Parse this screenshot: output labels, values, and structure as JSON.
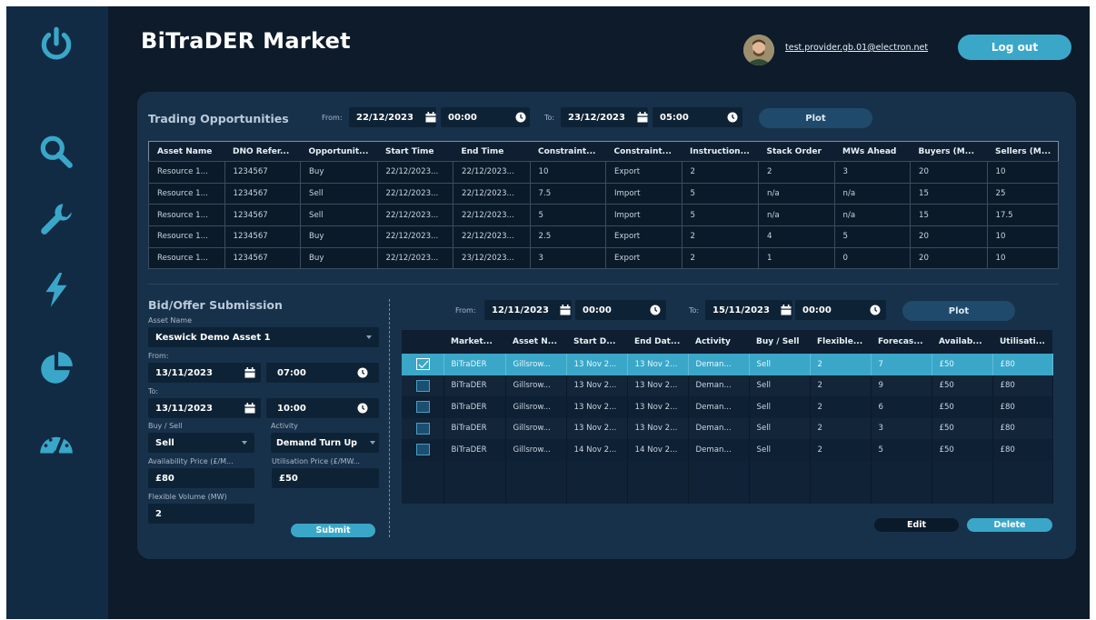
{
  "app": {
    "title": "BiTraDER Market"
  },
  "user": {
    "email": "test.provider.gb.01@electron.net",
    "avatar_icon": "user-avatar"
  },
  "header": {
    "logout_label": "Log out"
  },
  "sidebar": {
    "items": [
      {
        "icon": "power-icon"
      },
      {
        "icon": "search-icon"
      },
      {
        "icon": "wrench-icon"
      },
      {
        "icon": "lightning-icon"
      },
      {
        "icon": "pie-chart-icon"
      },
      {
        "icon": "gauge-icon"
      }
    ]
  },
  "colors": {
    "accent": "#3aa7c9",
    "background": "#0d1b2a",
    "sidebar": "#112b44",
    "card": "#18314b"
  },
  "trading": {
    "title": "Trading Opportunities",
    "from_label": "From:",
    "from_date": "22/12/2023",
    "from_time": "00:00",
    "to_label": "To:",
    "to_date": "23/12/2023",
    "to_time": "05:00",
    "plot_label": "Plot",
    "columns": [
      "Asset Name",
      "DNO Refer...",
      "Opportunit...",
      "Start Time",
      "End Time",
      "Constraint...",
      "Constraint...",
      "Instruction...",
      "Stack Order",
      "MWs Ahead",
      "Buyers (M...",
      "Sellers (M..."
    ],
    "rows": [
      [
        "Resource 1...",
        "1234567",
        "Buy",
        "22/12/2023...",
        "22/12/2023...",
        "10",
        "Export",
        "2",
        "2",
        "3",
        "20",
        "10"
      ],
      [
        "Resource 1...",
        "1234567",
        "Sell",
        "22/12/2023...",
        "22/12/2023...",
        "7.5",
        "Import",
        "5",
        "n/a",
        "n/a",
        "15",
        "25"
      ],
      [
        "Resource 1...",
        "1234567",
        "Sell",
        "22/12/2023...",
        "22/12/2023...",
        "5",
        "Import",
        "5",
        "n/a",
        "n/a",
        "15",
        "17.5"
      ],
      [
        "Resource 1...",
        "1234567",
        "Buy",
        "22/12/2023...",
        "22/12/2023...",
        "2.5",
        "Export",
        "2",
        "4",
        "5",
        "20",
        "10"
      ],
      [
        "Resource 1...",
        "1234567",
        "Buy",
        "22/12/2023...",
        "23/12/2023...",
        "3",
        "Export",
        "2",
        "1",
        "0",
        "20",
        "10"
      ]
    ]
  },
  "bid": {
    "title": "Bid/Offer Submission",
    "asset_label": "Asset Name",
    "asset_value": "Keswick Demo Asset 1",
    "from_label": "From:",
    "from_date": "13/11/2023",
    "from_time": "07:00",
    "to_label": "To:",
    "to_date": "13/11/2023",
    "to_time": "10:00",
    "buysell_label": "Buy / Sell",
    "buysell_value": "Sell",
    "activity_label": "Activity",
    "activity_value": "Demand Turn Up",
    "avail_label": "Availability Price (£/M...",
    "avail_value": "£80",
    "util_label": "Utilisation Price (£/MW...",
    "util_value": "£50",
    "flex_label": "Flexible Volume (MW)",
    "flex_value": "2",
    "submit_label": "Submit"
  },
  "bids": {
    "from_label": "From:",
    "from_date": "12/11/2023",
    "from_time": "00:00",
    "to_label": "To:",
    "to_date": "15/11/2023",
    "to_time": "00:00",
    "plot_label": "Plot",
    "columns": [
      "Market...",
      "Asset N...",
      "Start D...",
      "End Dat...",
      "Activity",
      "Buy / Sell",
      "Flexible...",
      "Forecas...",
      "Availab...",
      "Utilisati..."
    ],
    "rows": [
      {
        "selected": true,
        "cells": [
          "BiTraDER",
          "Gillsrow...",
          "13 Nov 2...",
          "13 Nov 2...",
          "Deman...",
          "Sell",
          "2",
          "7",
          "£50",
          "£80"
        ]
      },
      {
        "selected": false,
        "cells": [
          "BiTraDER",
          "Gillsrow...",
          "13 Nov 2...",
          "13 Nov 2...",
          "Deman...",
          "Sell",
          "2",
          "9",
          "£50",
          "£80"
        ]
      },
      {
        "selected": false,
        "cells": [
          "BiTraDER",
          "Gillsrow...",
          "13 Nov 2...",
          "13 Nov 2...",
          "Deman...",
          "Sell",
          "2",
          "6",
          "£50",
          "£80"
        ]
      },
      {
        "selected": false,
        "cells": [
          "BiTraDER",
          "Gillsrow...",
          "13 Nov 2...",
          "13 Nov 2...",
          "Deman...",
          "Sell",
          "2",
          "3",
          "£50",
          "£80"
        ]
      },
      {
        "selected": false,
        "cells": [
          "BiTraDER",
          "Gillsrow...",
          "14 Nov 2...",
          "14 Nov 2...",
          "Deman...",
          "Sell",
          "2",
          "5",
          "£50",
          "£80"
        ]
      }
    ],
    "edit_label": "Edit",
    "delete_label": "Delete"
  }
}
